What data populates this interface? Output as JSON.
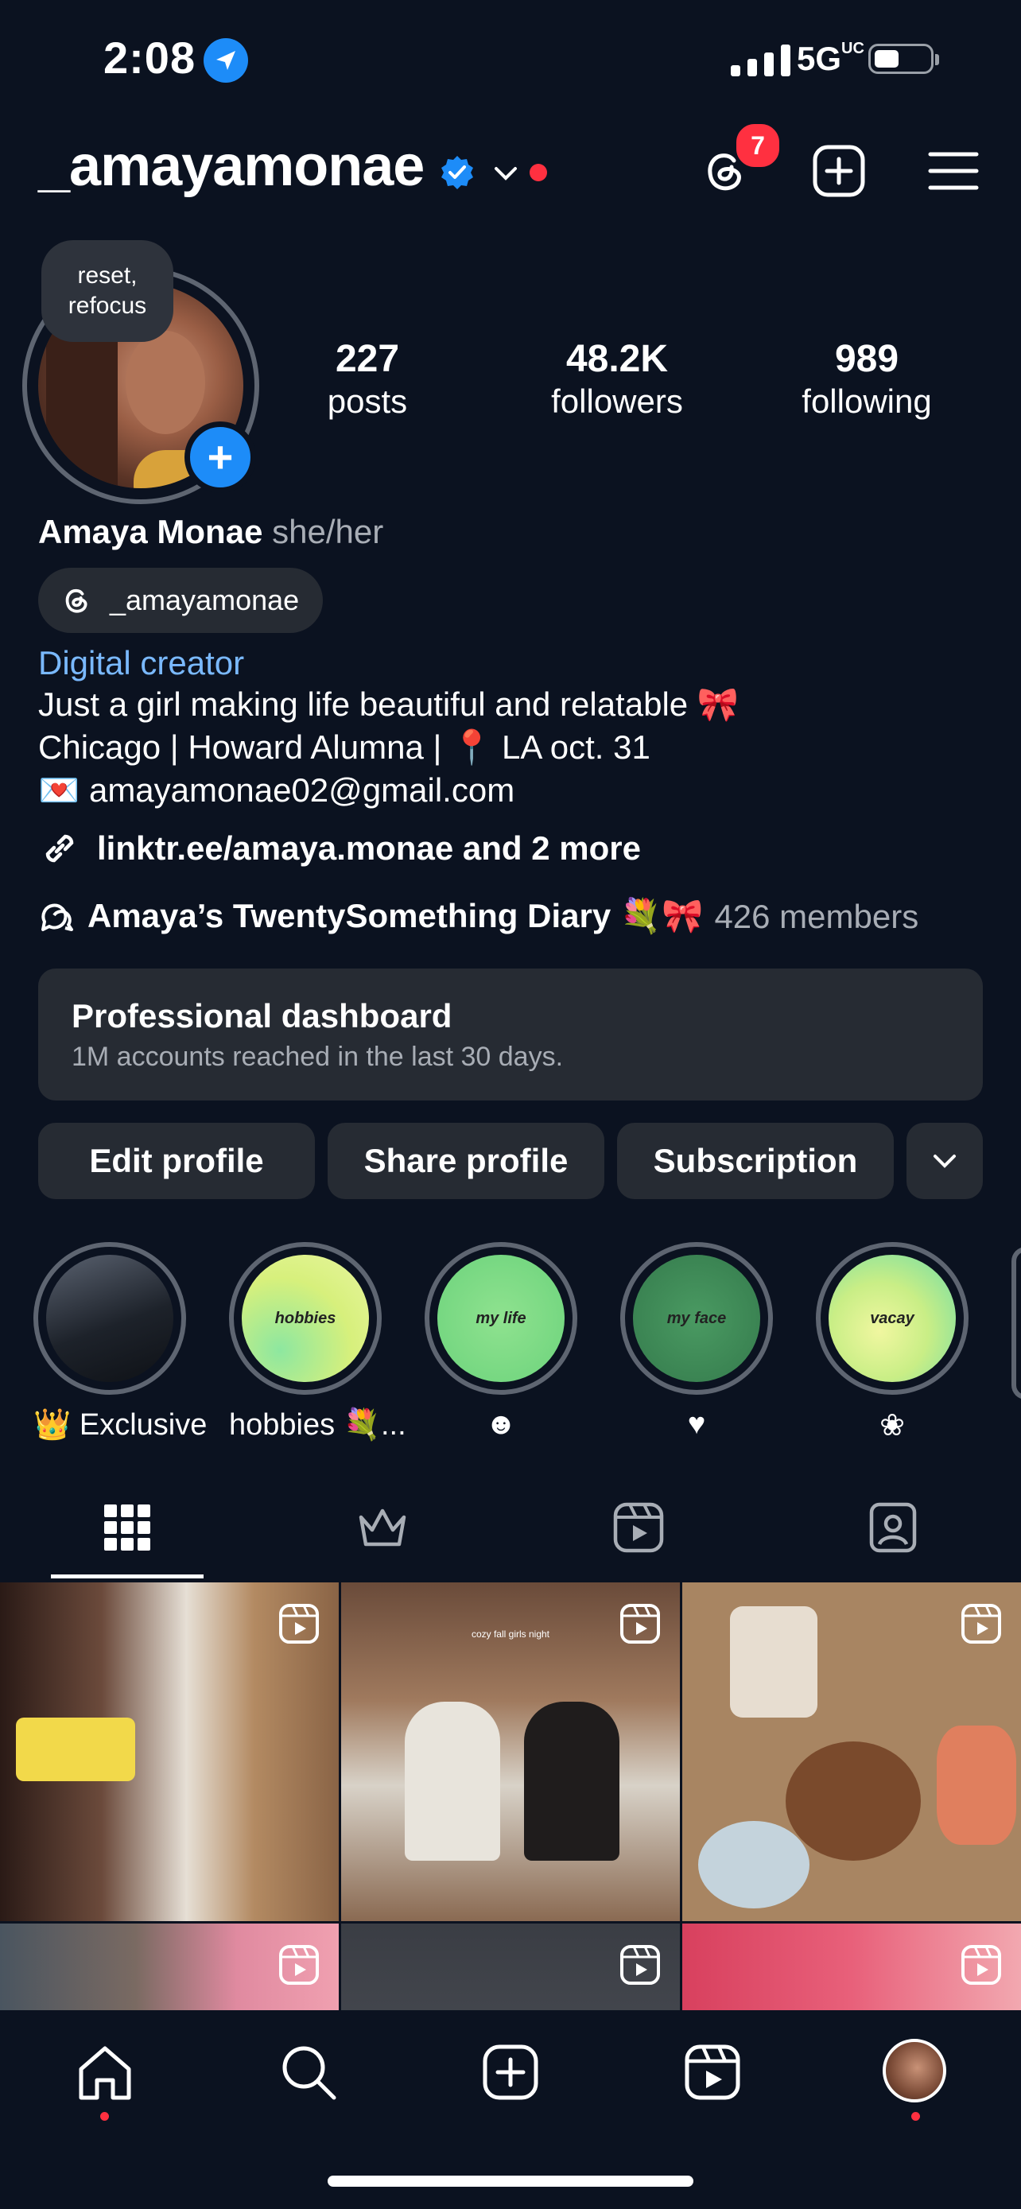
{
  "status_bar": {
    "time": "2:08",
    "network": "5G",
    "network_sup": "UC"
  },
  "header": {
    "username": "_amayamonae",
    "threads_badge": "7",
    "icons": [
      "threads-icon",
      "create-icon",
      "menu-icon"
    ]
  },
  "profile": {
    "note": "reset, refocus",
    "stats": [
      {
        "value": "227",
        "label": "posts"
      },
      {
        "value": "48.2K",
        "label": "followers"
      },
      {
        "value": "989",
        "label": "following"
      }
    ],
    "name": "Amaya Monae",
    "pronouns": "she/her",
    "threads_handle": "_amayamonae",
    "category": "Digital creator",
    "bio": [
      "Just a girl making life beautiful and relatable 🎀",
      "Chicago | Howard Alumna | 📍 LA oct. 31",
      "💌 amayamonae02@gmail.com"
    ],
    "link": "linktr.ee/amaya.monae and 2 more",
    "channel_name": "Amaya’s TwentySomething Diary 💐🎀",
    "channel_members": "426 members"
  },
  "dashboard": {
    "title": "Professional dashboard",
    "subtitle": "1M accounts reached in the last 30 days."
  },
  "actions": {
    "edit": "Edit profile",
    "share": "Share profile",
    "subscription": "Subscription"
  },
  "highlights": [
    {
      "label": "👑 Exclusive",
      "cover": "",
      "gradient": "#2a2f38"
    },
    {
      "label": "hobbies 💐...",
      "cover": "hobbies",
      "gradient": "#c8f08a"
    },
    {
      "label": "☻",
      "cover": "my life",
      "gradient": "#7bd77f"
    },
    {
      "label": "♥",
      "cover": "my face",
      "gradient": "#3f8a57"
    },
    {
      "label": "❀",
      "cover": "vacay",
      "gradient": "#d8f27a"
    }
  ],
  "grid": {
    "post2_caption": "cozy fall girls night"
  },
  "colors": {
    "background": "#0b1220",
    "accent_blue": "#1d8cf8",
    "notification_red": "#ff3040",
    "surface": "#262b33"
  }
}
